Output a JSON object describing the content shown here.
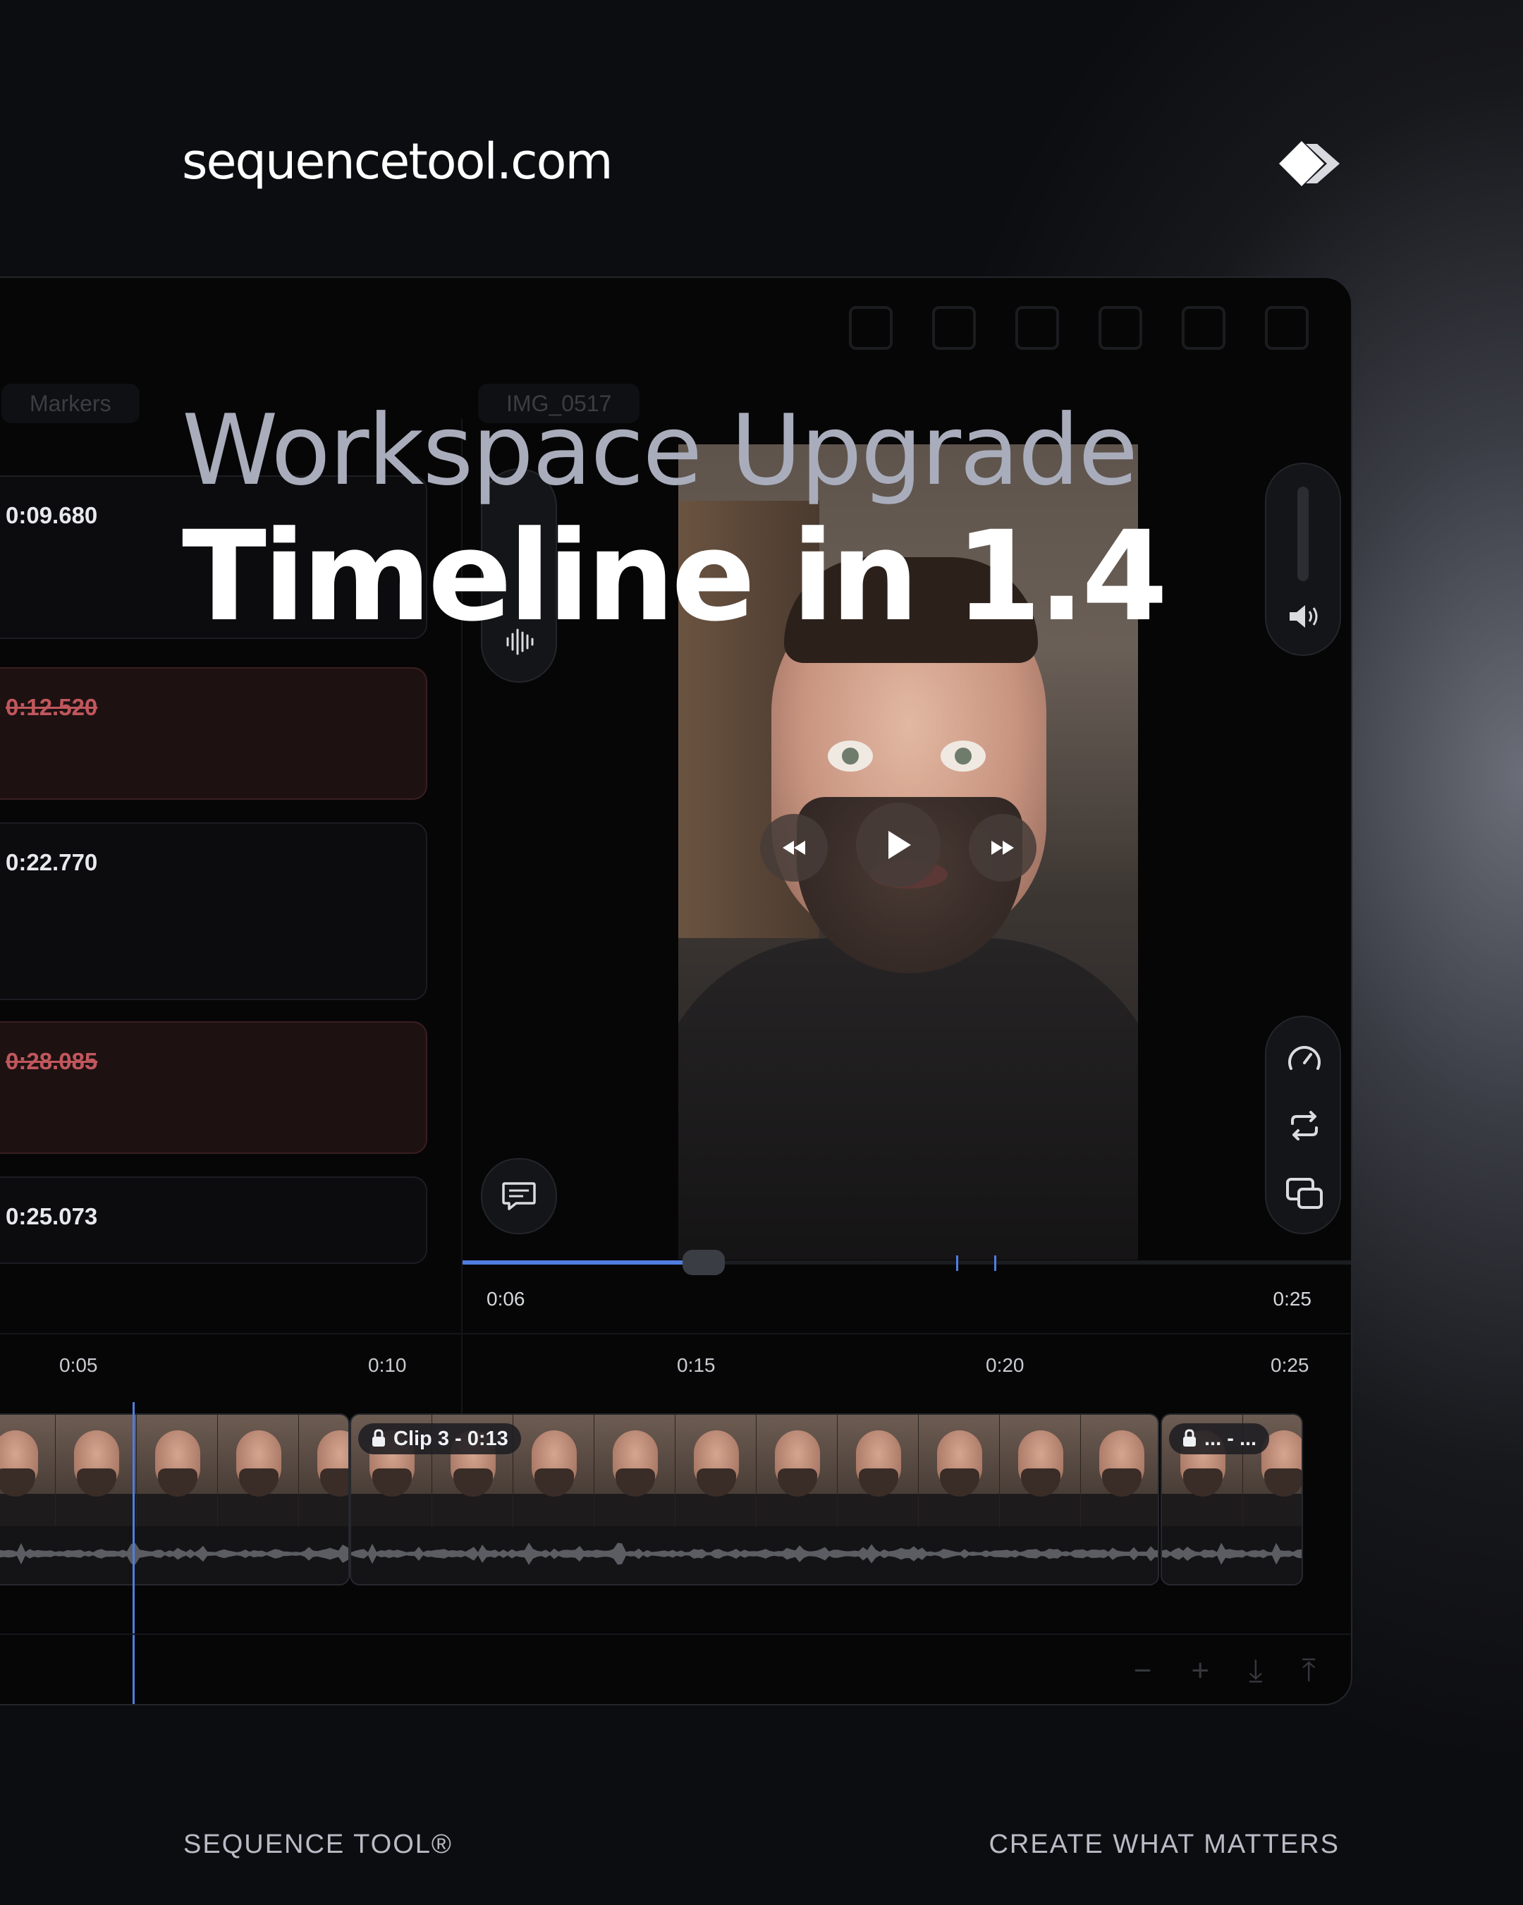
{
  "brand": {
    "site": "sequencetool.com",
    "logo_icon": "double-chevron-logo-icon"
  },
  "headline": {
    "line1": "Workspace Upgrade",
    "line2": "Timeline in 1.4"
  },
  "footer": {
    "left": "SEQUENCE TOOL®",
    "right": "CREATE WHAT MATTERS"
  },
  "app": {
    "tabs": {
      "markers": "Markers",
      "file": "IMG_0517"
    },
    "markers": [
      {
        "time": "0:09.680",
        "state": "normal"
      },
      {
        "time": "0:12.520",
        "state": "cut"
      },
      {
        "time": "0:22.770",
        "state": "normal"
      },
      {
        "time": "0:28.085",
        "state": "cut"
      },
      {
        "time": "0:25.073",
        "state": "normal"
      }
    ],
    "player": {
      "current": "0:06",
      "duration": "0:25",
      "progress": 0.24,
      "controls": [
        "rewind-icon",
        "play-icon",
        "fast-forward-icon"
      ]
    },
    "side_tools": [
      "speed-icon",
      "loop-icon",
      "pip-icon"
    ],
    "timeline": {
      "ticks": [
        "0:05",
        "0:10",
        "0:15",
        "0:20",
        "0:25"
      ],
      "clips": [
        {
          "label": ""
        },
        {
          "label": "Clip 3  -  0:13"
        },
        {
          "label": "...  -  ..."
        }
      ]
    },
    "zoom_controls": [
      "zoom-out-icon",
      "zoom-in-icon",
      "fit-down-icon",
      "fit-up-icon"
    ]
  },
  "colors": {
    "accent": "#4f7ee0",
    "cut": "#c0575c"
  }
}
